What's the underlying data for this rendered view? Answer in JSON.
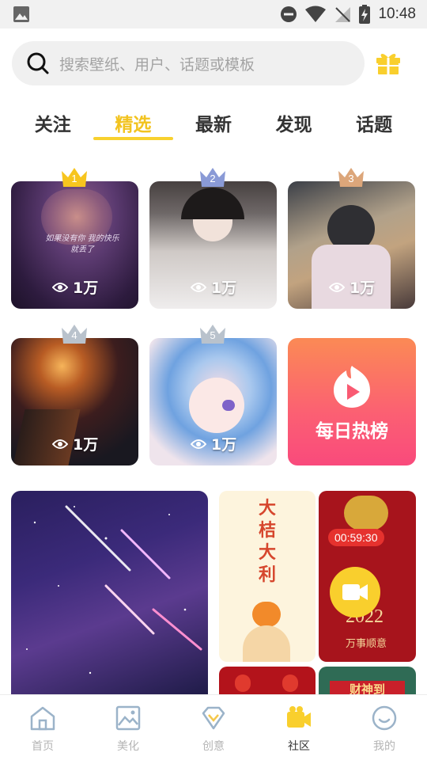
{
  "status_bar": {
    "time": "10:48"
  },
  "search": {
    "placeholder": "搜索壁纸、用户、话题或模板"
  },
  "tabs": [
    {
      "label": "关注",
      "active": false
    },
    {
      "label": "精选",
      "active": true
    },
    {
      "label": "最新",
      "active": false
    },
    {
      "label": "发现",
      "active": false
    },
    {
      "label": "话题",
      "active": false
    }
  ],
  "ranking": [
    {
      "rank": "1",
      "views": "1万",
      "crown_color": "#f7c51e",
      "caption": "如果没有你 我的快乐就丢了"
    },
    {
      "rank": "2",
      "views": "1万",
      "crown_color": "#8a9ad6"
    },
    {
      "rank": "3",
      "views": "1万",
      "crown_color": "#dca67a"
    },
    {
      "rank": "4",
      "views": "1万",
      "crown_color": "#b9c2cc"
    },
    {
      "rank": "5",
      "views": "1万",
      "crown_color": "#b9c2cc"
    }
  ],
  "hot_list": {
    "label": "每日热榜"
  },
  "feed": {
    "card2_text": [
      "大",
      "桔",
      "大",
      "利"
    ],
    "card3_timer": "00:59:30",
    "card3_year": "2022",
    "card3_sub": "万事顺意",
    "card4_text": "财神到"
  },
  "bottom_nav": [
    {
      "label": "首页",
      "icon": "home-icon",
      "active": false
    },
    {
      "label": "美化",
      "icon": "image-icon",
      "active": false
    },
    {
      "label": "创意",
      "icon": "diamond-icon",
      "active": false
    },
    {
      "label": "社区",
      "icon": "community-icon",
      "active": true
    },
    {
      "label": "我的",
      "icon": "smile-icon",
      "active": false
    }
  ],
  "colors": {
    "accent": "#f8d12e",
    "hot_gradient_top": "#fb8a55",
    "hot_gradient_bottom": "#f94a7c"
  }
}
